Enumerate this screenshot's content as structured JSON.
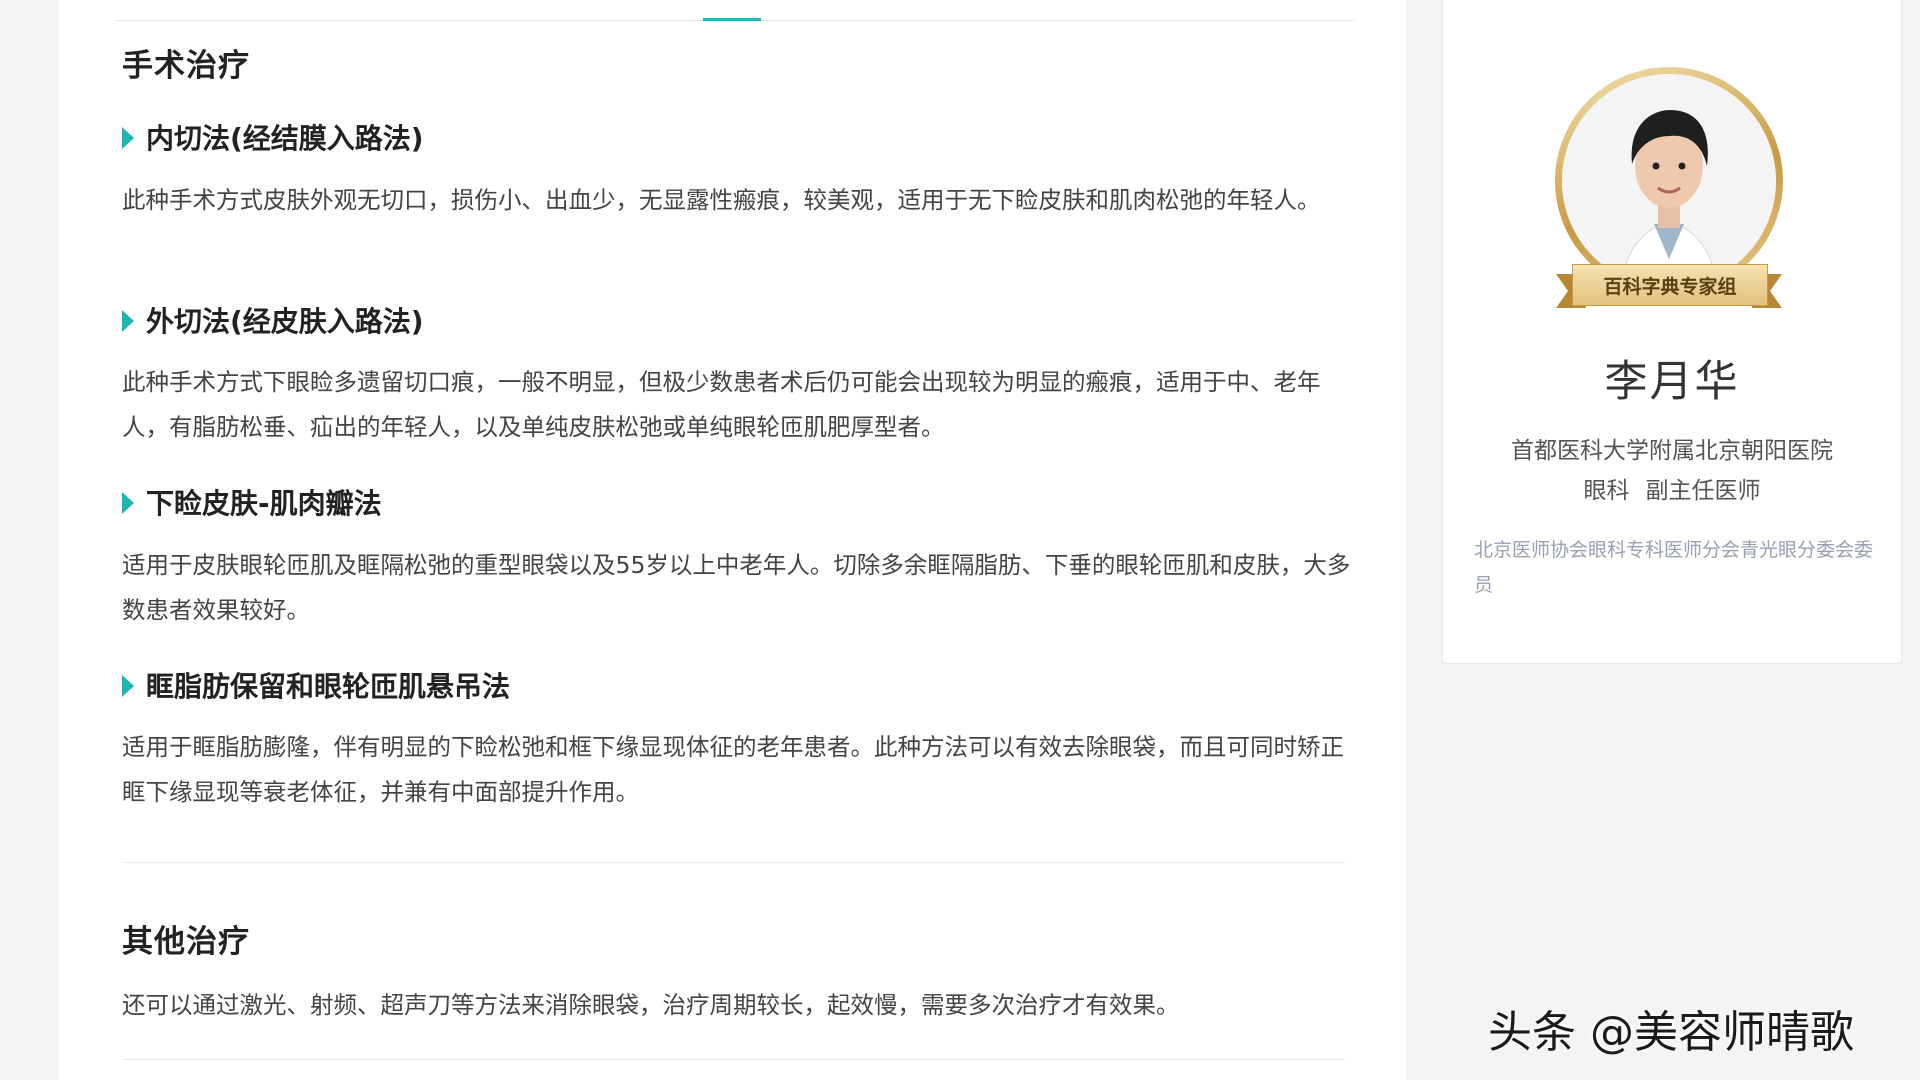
{
  "surgery_section": {
    "title": "手术治疗",
    "methods": [
      {
        "title": "内切法(经结膜入路法)",
        "description": "此种手术方式皮肤外观无切口，损伤小、出血少，无显露性瘢痕，较美观，适用于无下睑皮肤和肌肉松弛的年轻人。"
      },
      {
        "title": "外切法(经皮肤入路法)",
        "description": "此种手术方式下眼睑多遗留切口痕，一般不明显，但极少数患者术后仍可能会出现较为明显的瘢痕，适用于中、老年人，有脂肪松垂、疝出的年轻人，以及单纯皮肤松弛或单纯眼轮匝肌肥厚型者。"
      },
      {
        "title": "下睑皮肤-肌肉瓣法",
        "description": "适用于皮肤眼轮匝肌及眶隔松弛的重型眼袋以及55岁以上中老年人。切除多余眶隔脂肪、下垂的眼轮匝肌和皮肤，大多数患者效果较好。"
      },
      {
        "title": "眶脂肪保留和眼轮匝肌悬吊法",
        "description": "适用于眶脂肪膨隆，伴有明显的下睑松弛和框下缘显现体征的老年患者。此种方法可以有效去除眼袋，而且可同时矫正眶下缘显现等衰老体征，并兼有中面部提升作用。"
      }
    ]
  },
  "other_section": {
    "title": "其他治疗",
    "description": "还可以通过激光、射频、超声刀等方法来消除眼袋，治疗周期较长，起效慢，需要多次治疗才有效果。"
  },
  "expert_card": {
    "badge": "百科字典专家组",
    "name": "李月华",
    "hospital": "首都医科大学附属北京朝阳医院",
    "department": "眼科",
    "position": "副主任医师",
    "affiliation": "北京医师协会眼科专科医师分会青光眼分委会委员"
  },
  "watermark": "头条 @美容师晴歌",
  "colors": {
    "accent": "#1db7b1",
    "badge_gold": "#c99a43",
    "affiliation_text": "#9aa0b4",
    "page_background": "#f3f4f6"
  }
}
